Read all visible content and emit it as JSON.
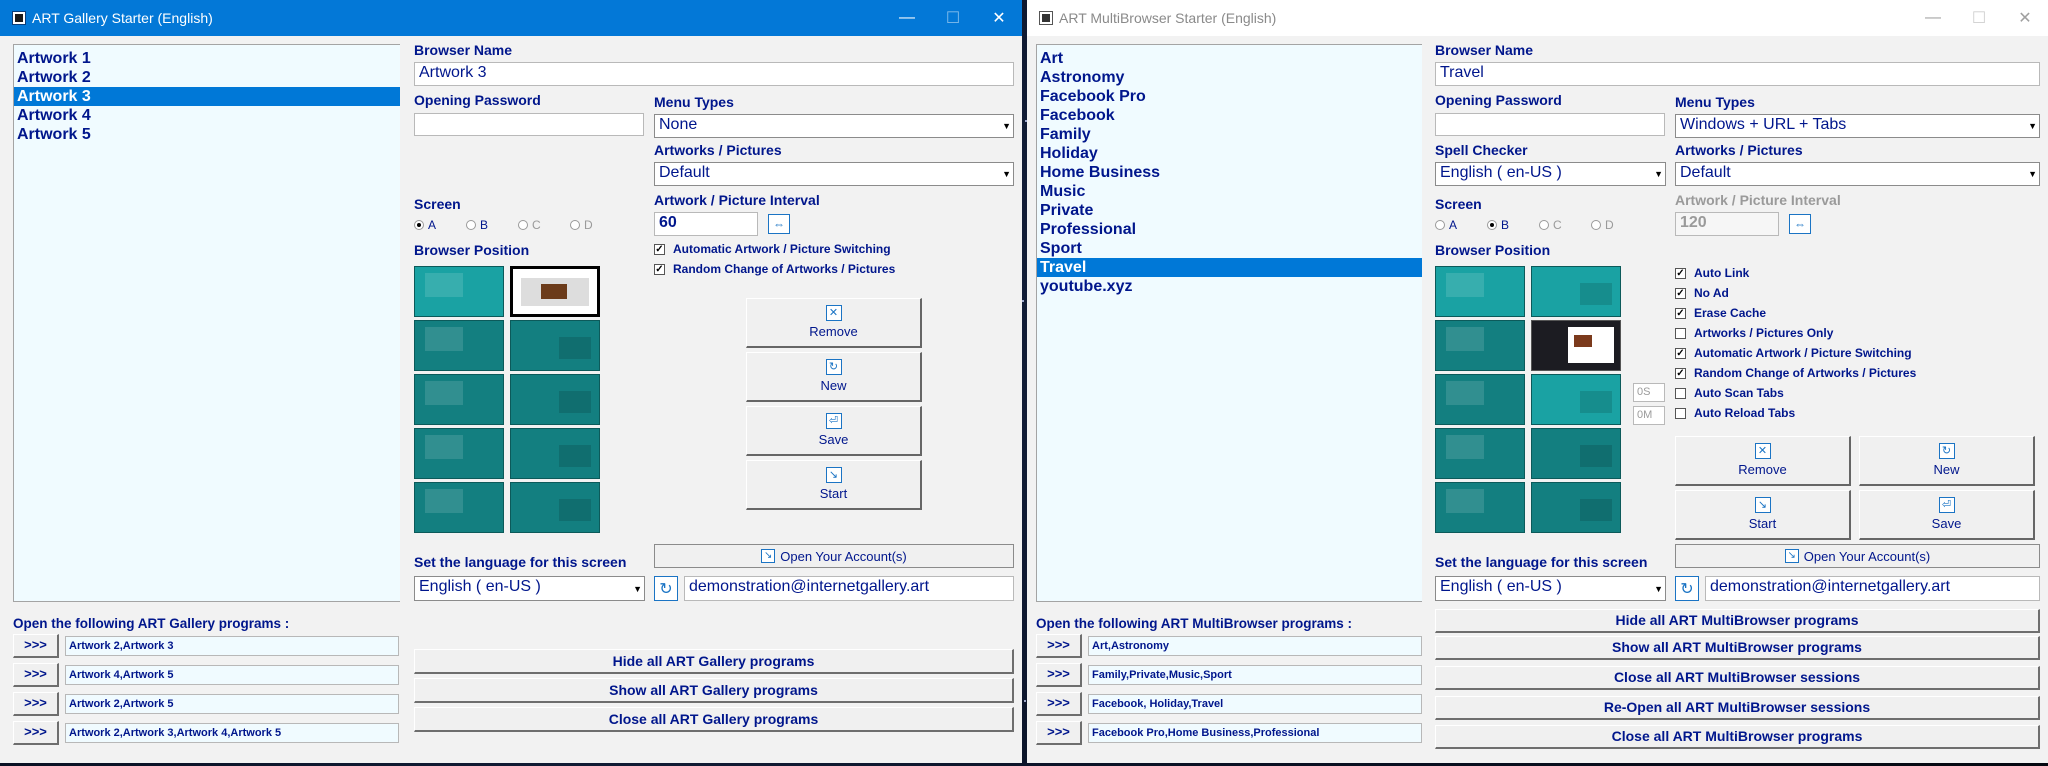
{
  "gallery": {
    "title": "ART Gallery Starter (English)",
    "controls": {
      "minimize": "—",
      "maximize": "☐",
      "close": "✕"
    },
    "list": [
      "Artwork 1",
      "Artwork 2",
      "Artwork 3",
      "Artwork 4",
      "Artwork 5"
    ],
    "selected_index": 2,
    "browser_name_label": "Browser Name",
    "browser_name": "Artwork 3",
    "password_label": "Opening Password",
    "password": "",
    "menu_types_label": "Menu Types",
    "menu_type": "None",
    "artworks_label": "Artworks / Pictures",
    "artworks_value": "Default",
    "interval_label": "Artwork / Picture Interval",
    "interval": "60",
    "screen_label": "Screen",
    "screens": [
      {
        "label": "A",
        "selected": true,
        "enabled": true
      },
      {
        "label": "B",
        "selected": false,
        "enabled": true
      },
      {
        "label": "C",
        "selected": false,
        "enabled": false
      },
      {
        "label": "D",
        "selected": false,
        "enabled": false
      }
    ],
    "position_label": "Browser Position",
    "checks": [
      {
        "label": "Automatic Artwork / Picture Switching",
        "checked": true
      },
      {
        "label": "Random Change of Artworks / Pictures",
        "checked": true
      }
    ],
    "buttons": {
      "remove": "Remove",
      "new": "New",
      "save": "Save",
      "start": "Start"
    },
    "open_account": "Open Your Account(s)",
    "language_label": "Set the language for this screen",
    "language": "English ( en-US )",
    "email": "demonstration@internetgallery.art",
    "programs_label": "Open the following ART Gallery programs :",
    "programs": [
      "Artwork 2,Artwork 3",
      "Artwork 4,Artwork 5",
      "Artwork 2,Artwork 5",
      "Artwork 2,Artwork 3,Artwork 4,Artwork 5"
    ],
    "go_label": ">>>",
    "hide_all": "Hide all ART Gallery programs",
    "show_all": "Show all ART Gallery programs",
    "close_all": "Close all ART Gallery programs"
  },
  "multi": {
    "title": "ART MultiBrowser Starter (English)",
    "controls": {
      "minimize": "—",
      "maximize": "☐",
      "close": "✕"
    },
    "list": [
      "Art",
      "Astronomy",
      "Facebook Pro",
      "Facebook",
      "Family",
      "Holiday",
      "Home Business",
      "Music",
      "Private",
      "Professional",
      "Sport",
      "Travel",
      "youtube.xyz"
    ],
    "selected_index": 11,
    "browser_name_label": "Browser Name",
    "browser_name": "Travel",
    "password_label": "Opening Password",
    "password": "",
    "menu_types_label": "Menu Types",
    "menu_type": "Windows + URL + Tabs",
    "spell_label": "Spell Checker",
    "spell": "English ( en-US )",
    "artworks_label": "Artworks / Pictures",
    "artworks_value": "Default",
    "interval_label": "Artwork / Picture Interval",
    "interval": "120",
    "screen_label": "Screen",
    "screens": [
      {
        "label": "A",
        "selected": false,
        "enabled": true
      },
      {
        "label": "B",
        "selected": true,
        "enabled": true
      },
      {
        "label": "C",
        "selected": false,
        "enabled": false
      },
      {
        "label": "D",
        "selected": false,
        "enabled": false
      }
    ],
    "position_label": "Browser Position",
    "scan_seconds": "0S",
    "reload_minutes": "0M",
    "checks": [
      {
        "label": "Auto Link",
        "checked": true
      },
      {
        "label": "No Ad",
        "checked": true
      },
      {
        "label": "Erase Cache",
        "checked": true
      },
      {
        "label": "Artworks / Pictures Only",
        "checked": false
      },
      {
        "label": "Automatic Artwork / Picture Switching",
        "checked": true
      },
      {
        "label": "Random Change of Artworks / Pictures",
        "checked": true
      },
      {
        "label": "Auto Scan Tabs",
        "checked": false
      },
      {
        "label": "Auto Reload Tabs",
        "checked": false
      }
    ],
    "buttons": {
      "remove": "Remove",
      "new": "New",
      "start": "Start",
      "save": "Save"
    },
    "open_account": "Open Your Account(s)",
    "language_label": "Set the language for this screen",
    "language": "English ( en-US )",
    "email": "demonstration@internetgallery.art",
    "programs_label": "Open the following ART MultiBrowser programs :",
    "programs": [
      "Art,Astronomy",
      "Family,Private,Music,Sport",
      "Facebook, Holiday,Travel",
      "Facebook Pro,Home Business,Professional"
    ],
    "go_label": ">>>",
    "hide_all": "Hide all ART MultiBrowser programs",
    "show_all": "Show all ART MultiBrowser programs",
    "close_sessions": "Close all ART MultiBrowser sessions",
    "reopen_sessions": "Re-Open all ART MultiBrowser sessions",
    "close_all": "Close all ART MultiBrowser programs"
  },
  "icons": {
    "remove": "✕",
    "new": "↻",
    "save": "⏎",
    "start": "↘",
    "refresh": "↻",
    "interval": "⇔",
    "account": "↘"
  }
}
